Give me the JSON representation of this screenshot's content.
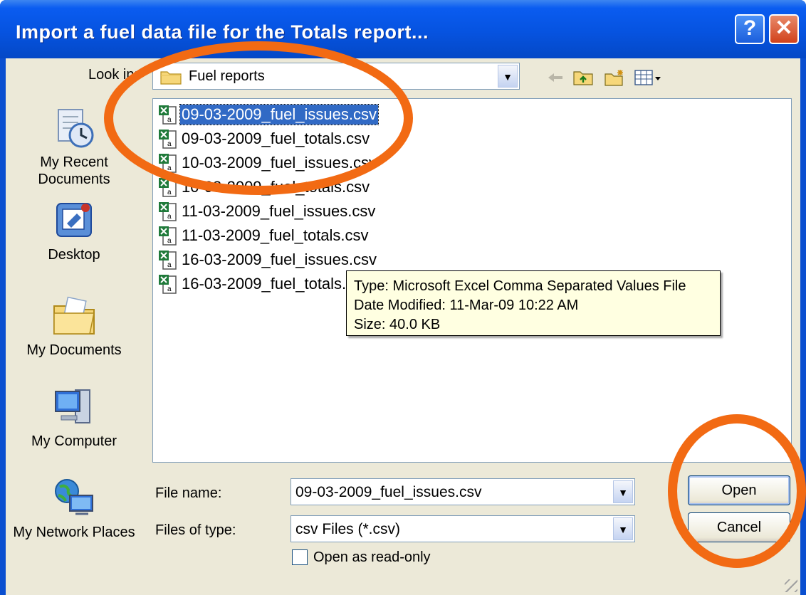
{
  "window": {
    "title": "Import a fuel data file for the Totals report...",
    "help_label": "?",
    "close_label": "✕"
  },
  "lookin": {
    "label": "Look in:",
    "value": "Fuel reports"
  },
  "places": [
    {
      "label": "My Recent Documents",
      "icon": "recent-documents-icon"
    },
    {
      "label": "Desktop",
      "icon": "desktop-icon"
    },
    {
      "label": "My Documents",
      "icon": "my-documents-icon"
    },
    {
      "label": "My Computer",
      "icon": "my-computer-icon"
    },
    {
      "label": "My Network Places",
      "icon": "network-places-icon"
    }
  ],
  "files": [
    {
      "name": "09-03-2009_fuel_issues.csv",
      "selected": true
    },
    {
      "name": "09-03-2009_fuel_totals.csv"
    },
    {
      "name": "10-03-2009_fuel_issues.csv"
    },
    {
      "name": "10-03-2009_fuel_totals.csv"
    },
    {
      "name": "11-03-2009_fuel_issues.csv"
    },
    {
      "name": "11-03-2009_fuel_totals.csv"
    },
    {
      "name": "16-03-2009_fuel_issues.csv"
    },
    {
      "name": "16-03-2009_fuel_totals.csv"
    }
  ],
  "tooltip": {
    "type": "Type: Microsoft Excel Comma Separated Values File",
    "modified": "Date Modified: 11-Mar-09 10:22 AM",
    "size": "Size: 40.0 KB"
  },
  "filename": {
    "label": "File name:",
    "value": "09-03-2009_fuel_issues.csv"
  },
  "filetype": {
    "label": "Files of type:",
    "value": "csv Files (*.csv)"
  },
  "readonly": {
    "label": "Open as read-only",
    "checked": false
  },
  "buttons": {
    "open": "Open",
    "cancel": "Cancel"
  },
  "colors": {
    "titlebar": "#0653e0",
    "selection": "#316ac5",
    "annotation": "#f26a13",
    "tooltip_bg": "#ffffe1"
  }
}
